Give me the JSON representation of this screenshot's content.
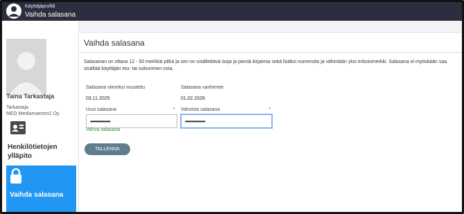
{
  "header": {
    "subtitle": "Käyttäjäprofiili",
    "title": "Vaihda salasana"
  },
  "sidebar": {
    "user_name": "Taina Tarkastaja",
    "user_role": "Tarkastaja",
    "user_org": "MED Mediamaestro2 Oy",
    "menu_people": "Henkilötietojen ylläpito",
    "menu_change_password": "Vaihda salasana"
  },
  "main": {
    "title": "Vaihda salasana",
    "description": "Salasanan on oltava 12 - 50 merkkiä pitkä ja sen on sisällettävä isoja ja pieniä kirjaimia sekä lisäksi numeroita ja vähintään yksi erikoismerkki. Salasana ei myöskään saa sisältää käyttäjän etu- tai sukunimen osia.",
    "last_changed_label": "Salasana viimeksi muutettu",
    "last_changed_value": "03.11.2025",
    "expires_label": "Salasana vanhenee",
    "expires_value": "01.02.2026",
    "new_password_label": "Uusi salasana",
    "new_password_value": "••••••••••••••••",
    "confirm_password_label": "Vahvista salasana",
    "confirm_password_value": "••••••••••••••••",
    "required_marker": "*",
    "strength_text": "Vahva salasana",
    "save_label": "TALLENNA"
  },
  "colors": {
    "topbar": "#2b2e3f",
    "active_menu": "#2196f3",
    "save_button": "#607d8b",
    "strength": "#2e8b2e"
  },
  "icons": [
    "user-avatar-icon",
    "back-arrow-icon",
    "id-card-icon",
    "lock-icon"
  ]
}
